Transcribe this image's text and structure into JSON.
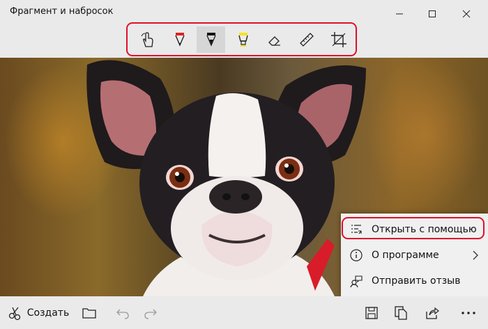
{
  "window": {
    "title": "Фрагмент и набросок"
  },
  "toolbar": {
    "tools": [
      {
        "icon": "touch-writing-icon",
        "selected": false
      },
      {
        "icon": "ballpoint-pen-icon",
        "selected": false,
        "color": "#e02020"
      },
      {
        "icon": "pencil-icon",
        "selected": true,
        "color": "#111111"
      },
      {
        "icon": "highlighter-icon",
        "selected": false,
        "color": "#f5e21a"
      },
      {
        "icon": "eraser-icon",
        "selected": false
      },
      {
        "icon": "ruler-icon",
        "selected": false
      },
      {
        "icon": "crop-icon",
        "selected": false
      }
    ]
  },
  "bottombar": {
    "create_label": "Создать"
  },
  "context_menu": {
    "items": [
      {
        "label": "Открыть с помощью",
        "icon": "open-with-icon"
      },
      {
        "label": "О программе",
        "icon": "info-icon"
      },
      {
        "label": "Отправить отзыв",
        "icon": "feedback-icon"
      }
    ]
  },
  "colors": {
    "highlight": "#e0102a",
    "pen": "#e02020",
    "highlighter": "#f5e21a"
  }
}
